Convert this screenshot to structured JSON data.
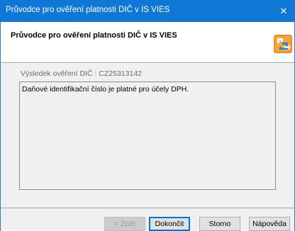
{
  "window": {
    "title": "Průvodce pro ověření platnosti DIČ v IS VIES",
    "close_glyph": "✕"
  },
  "header": {
    "title": "Průvodce pro ověření platnosti DIČ v IS VIES",
    "logo_icon": "wizard-logo-icon"
  },
  "content": {
    "result_label": "Výsledek ověření DIČ : CZ25313142",
    "result_message": "Daňové identifikační číslo je platné pro účely DPH."
  },
  "buttons": {
    "back": "< Zpět",
    "finish": "Dokončit",
    "cancel": "Storno",
    "help": "Nápověda"
  },
  "colors": {
    "titlebar": "#0f78d7",
    "accent": "#0078d7",
    "panel": "#f0f0f0"
  }
}
